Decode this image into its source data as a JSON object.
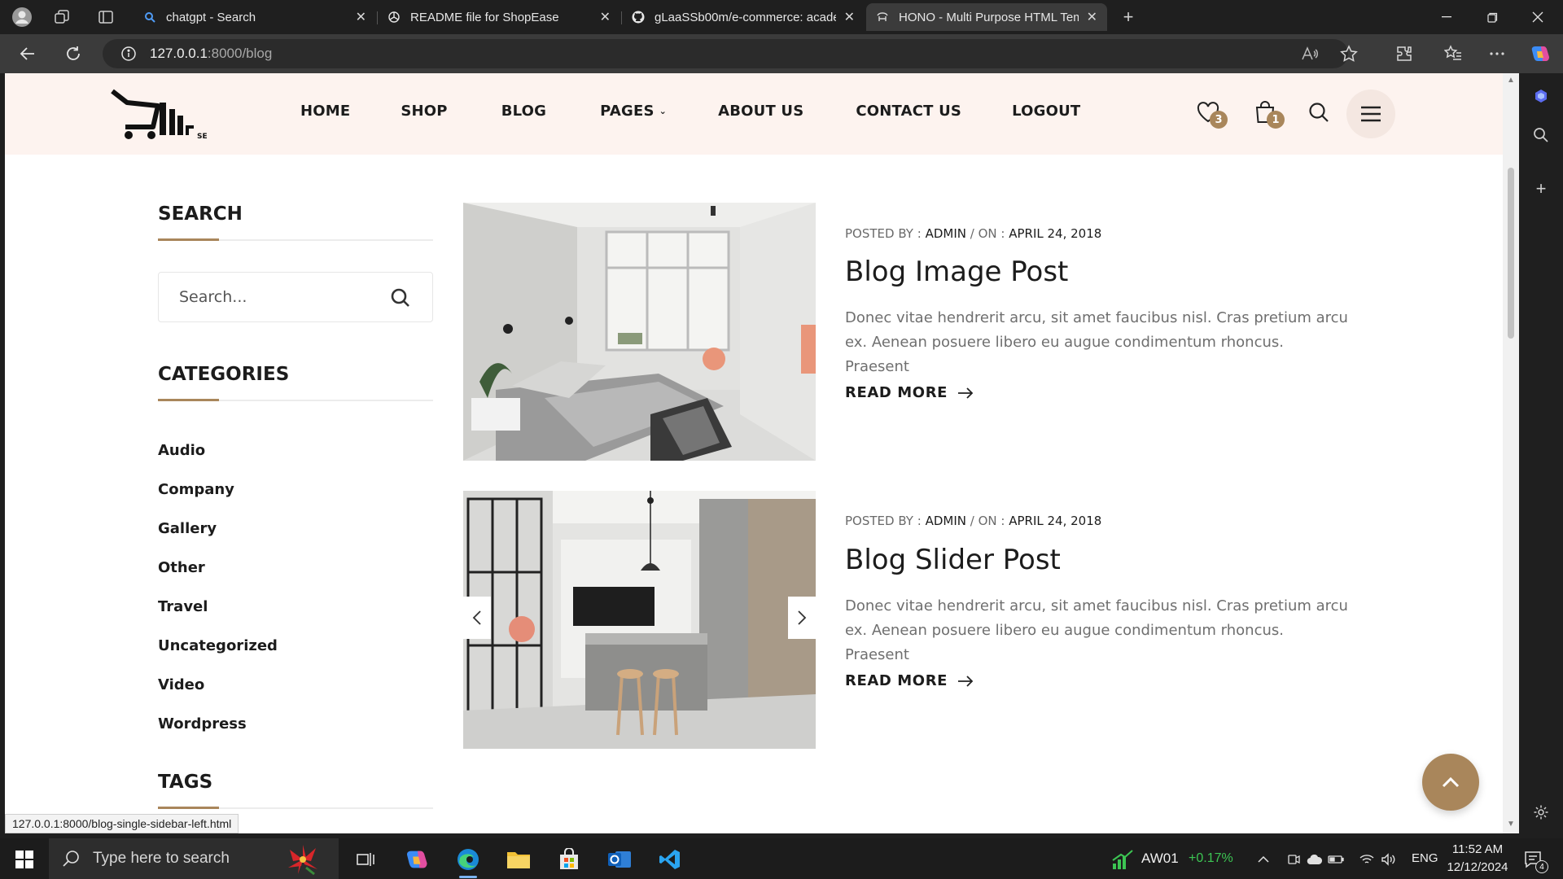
{
  "browser": {
    "tabs": [
      {
        "title": "chatgpt - Search",
        "icon": "bing-search-icon",
        "active": false
      },
      {
        "title": "README file for ShopEase",
        "icon": "chatgpt-icon",
        "active": false
      },
      {
        "title": "gLaaSSb00m/e-commerce: acade",
        "icon": "github-icon",
        "active": false
      },
      {
        "title": "HONO - Multi Purpose HTML Tem",
        "icon": "site-favicon",
        "active": true
      }
    ],
    "url_host": "127.0.0.1",
    "url_path": ":8000/blog",
    "status_url": "127.0.0.1:8000/blog-single-sidebar-left.html"
  },
  "site": {
    "logo_text": "ShopEase",
    "nav": [
      {
        "label": "HOME"
      },
      {
        "label": "SHOP"
      },
      {
        "label": "BLOG"
      },
      {
        "label": "PAGES",
        "has_dropdown": true
      },
      {
        "label": "ABOUT US"
      },
      {
        "label": "CONTACT US"
      },
      {
        "label": "LOGOUT"
      }
    ],
    "wishlist_count": "3",
    "cart_count": "1"
  },
  "sidebar": {
    "search_title": "SEARCH",
    "search_placeholder": "Search...",
    "categories_title": "CATEGORIES",
    "categories": [
      "Audio",
      "Company",
      "Gallery",
      "Other",
      "Travel",
      "Uncategorized",
      "Video",
      "Wordpress"
    ],
    "tags_title": "TAGS"
  },
  "posts": [
    {
      "posted_by_label": "POSTED BY :",
      "author": "ADMIN",
      "on_label": "/ ON :",
      "date": "APRIL 24, 2018",
      "title": "Blog Image Post",
      "excerpt": "Donec vitae hendrerit arcu, sit amet faucibus nisl. Cras pretium arcu ex. Aenean posuere libero eu augue condimentum rhoncus. Praesent",
      "read_more": "READ MORE",
      "media": "image"
    },
    {
      "posted_by_label": "POSTED BY :",
      "author": "ADMIN",
      "on_label": "/ ON :",
      "date": "APRIL 24, 2018",
      "title": "Blog Slider Post",
      "excerpt": "Donec vitae hendrerit arcu, sit amet faucibus nisl. Cras pretium arcu ex. Aenean posuere libero eu augue condimentum rhoncus. Praesent",
      "read_more": "READ MORE",
      "media": "slider"
    }
  ],
  "taskbar": {
    "search_placeholder": "Type here to search",
    "stock_name": "AW01",
    "stock_change": "+0.17%",
    "language": "ENG",
    "time": "11:52 AM",
    "date": "12/12/2024",
    "notification_count": "4"
  },
  "colors": {
    "accent": "#a9865b",
    "header_bg": "#fdf3ef",
    "stock_up": "#3cc553"
  }
}
